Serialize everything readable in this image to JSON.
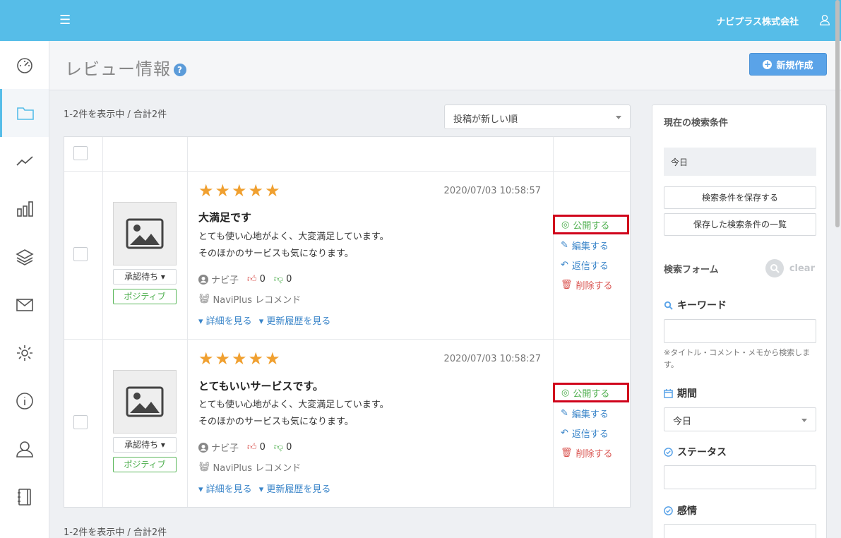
{
  "topbar": {
    "menu_icon": "hamburger-icon",
    "company": "ナビプラス株式会社",
    "user_icon": "user-icon"
  },
  "sidebar": {
    "items": [
      {
        "icon": "dashboard-icon",
        "active": false
      },
      {
        "icon": "folder-icon",
        "active": true
      },
      {
        "icon": "line-chart-icon",
        "active": false
      },
      {
        "icon": "bar-chart-icon",
        "active": false
      },
      {
        "icon": "layers-icon",
        "active": false
      },
      {
        "icon": "mail-icon",
        "active": false
      },
      {
        "icon": "settings-icon",
        "active": false
      },
      {
        "icon": "info-icon",
        "active": false
      },
      {
        "icon": "user-icon",
        "active": false
      },
      {
        "icon": "notebook-icon",
        "active": false
      }
    ]
  },
  "header": {
    "title": "レビュー情報",
    "help": "?",
    "new_button": "新規作成"
  },
  "list": {
    "count_top": "1-2件を表示中 / 合計2件",
    "count_bottom": "1-2件を表示中 / 合計2件",
    "sort_value": "投稿が新しい順",
    "reviews": [
      {
        "rating": 5,
        "date": "2020/07/03 10:58:57",
        "title": "大満足です",
        "body_line1": "とても使い心地がよく、大変満足しています。",
        "body_line2": "そのほかのサービスも気になります。",
        "author": "ナビ子",
        "likes": "0",
        "dislikes": "0",
        "product": "NaviPlus レコメンド",
        "detail_link": "詳細を見る",
        "history_link": "更新履歴を見る",
        "status": "承認待ち",
        "sentiment": "ポジティブ",
        "actions": {
          "publish": "公開する",
          "edit": "編集する",
          "reply": "返信する",
          "delete": "削除する"
        }
      },
      {
        "rating": 5,
        "date": "2020/07/03 10:58:27",
        "title": "とてもいいサービスです。",
        "body_line1": "とても使い心地がよく、大変満足しています。",
        "body_line2": "そのほかのサービスも気になります。",
        "author": "ナビ子",
        "likes": "0",
        "dislikes": "0",
        "product": "NaviPlus レコメンド",
        "detail_link": "詳細を見る",
        "history_link": "更新履歴を見る",
        "status": "承認待ち",
        "sentiment": "ポジティブ",
        "actions": {
          "publish": "公開する",
          "edit": "編集する",
          "reply": "返信する",
          "delete": "削除する"
        }
      }
    ]
  },
  "panel": {
    "current_title": "現在の検索条件",
    "current_value": "今日",
    "save_button": "検索条件を保存する",
    "saved_list_button": "保存した検索条件の一覧",
    "form_title": "検索フォーム",
    "clear": "clear",
    "keyword_label": "キーワード",
    "keyword_value": "",
    "keyword_note": "※タイトル・コメント・メモから検索します。",
    "period_label": "期間",
    "period_value": "今日",
    "status_label": "ステータス",
    "emotion_label": "感情"
  },
  "colors": {
    "topbar": "#56bde8",
    "accent": "#5aa3e8",
    "publish": "#4cae4c",
    "delete": "#d9534f",
    "highlight": "#d0021b",
    "star": "#f0a030"
  }
}
